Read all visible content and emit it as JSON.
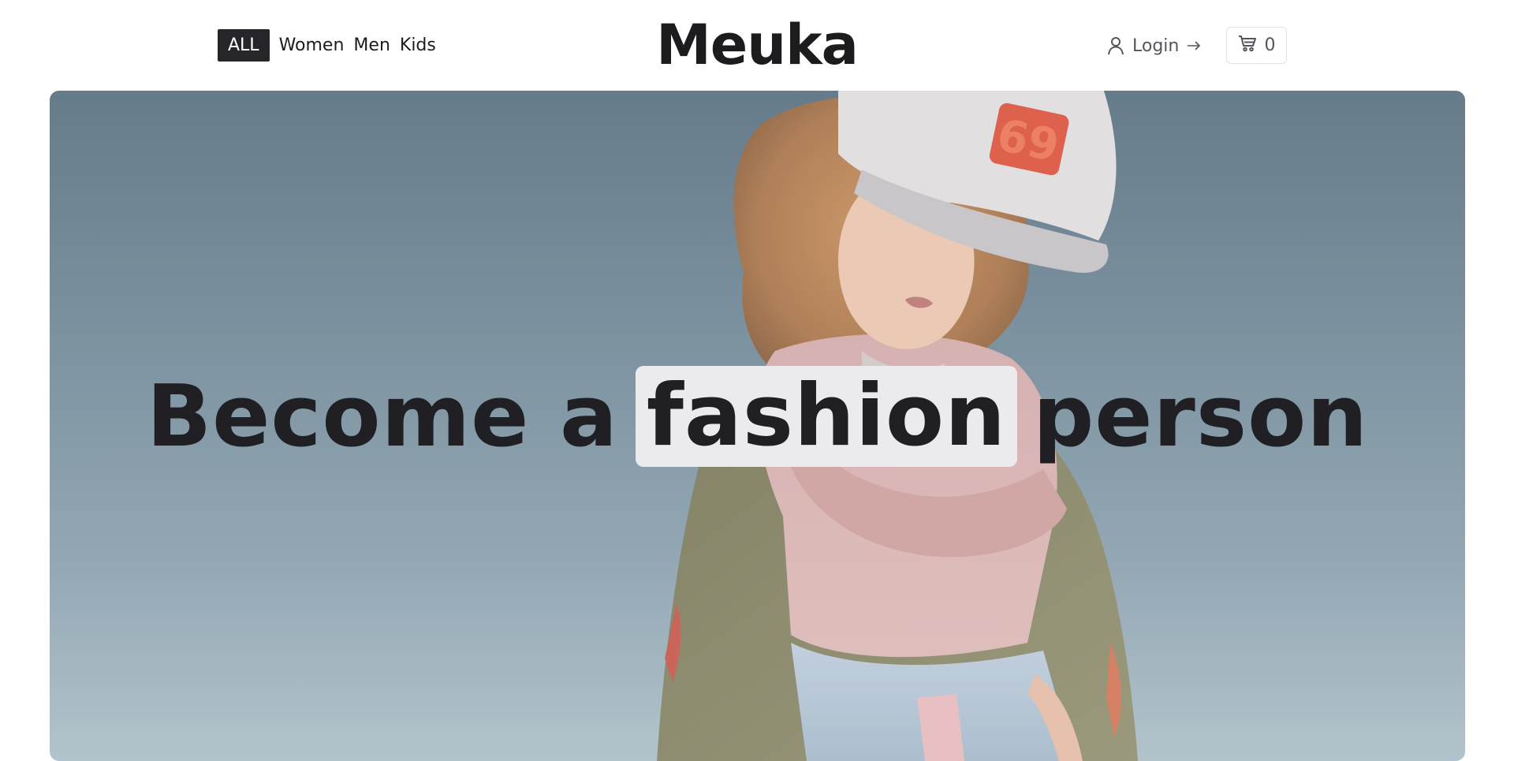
{
  "nav": {
    "items": [
      {
        "label": "ALL",
        "active": true
      },
      {
        "label": "Women",
        "active": false
      },
      {
        "label": "Men",
        "active": false
      },
      {
        "label": "Kids",
        "active": false
      }
    ]
  },
  "brand": {
    "name": "Meuka"
  },
  "account": {
    "login_label": "Login",
    "icon": "user-icon",
    "arrow_icon": "arrow-right-icon"
  },
  "cart": {
    "count": "0",
    "icon": "cart-icon"
  },
  "hero": {
    "headline_part1": "Become a",
    "headline_highlight": "fashion",
    "headline_part2": "person",
    "image": "model-in-cap-and-sweater-photo"
  },
  "colors": {
    "accent_dark": "#26262a",
    "text": "#1c1c1f",
    "highlight_bg": "#ebebed"
  }
}
